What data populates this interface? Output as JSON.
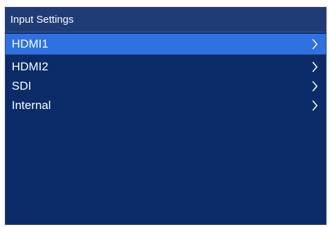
{
  "header": {
    "title": "Input Settings"
  },
  "menu": {
    "items": [
      {
        "label": "HDMI1",
        "selected": true,
        "icon": "chevron-right-icon"
      },
      {
        "label": "HDMI2",
        "selected": false,
        "icon": "chevron-right-icon"
      },
      {
        "label": "SDI",
        "selected": false,
        "icon": "chevron-right-icon"
      },
      {
        "label": "Internal",
        "selected": false,
        "icon": "chevron-right-icon"
      }
    ]
  },
  "colors": {
    "panel_bg": "#0b2c69",
    "header_bg": "#1f3c77",
    "selected_bg": "#2f71e0",
    "text": "#ffffff"
  }
}
